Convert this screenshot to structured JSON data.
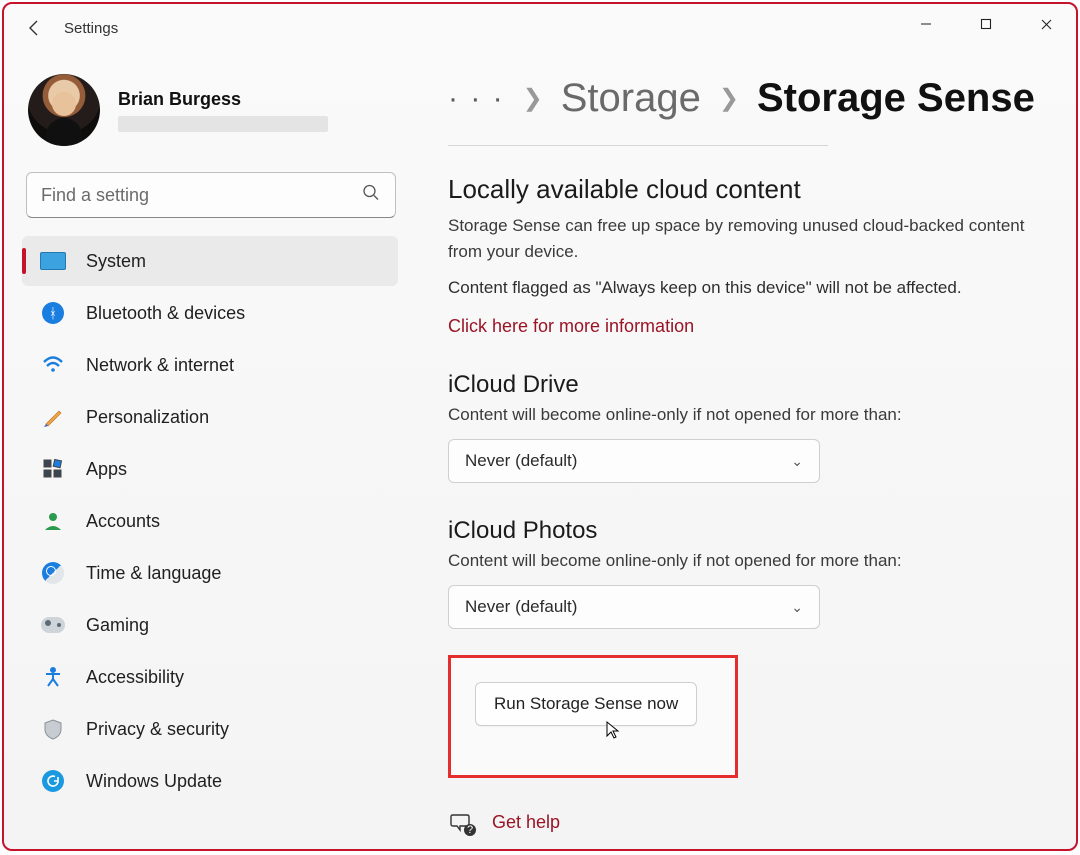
{
  "titlebar": {
    "title": "Settings"
  },
  "user": {
    "name": "Brian Burgess"
  },
  "search": {
    "placeholder": "Find a setting"
  },
  "nav": {
    "items": [
      {
        "label": "System"
      },
      {
        "label": "Bluetooth & devices"
      },
      {
        "label": "Network & internet"
      },
      {
        "label": "Personalization"
      },
      {
        "label": "Apps"
      },
      {
        "label": "Accounts"
      },
      {
        "label": "Time & language"
      },
      {
        "label": "Gaming"
      },
      {
        "label": "Accessibility"
      },
      {
        "label": "Privacy & security"
      },
      {
        "label": "Windows Update"
      }
    ]
  },
  "breadcrumb": {
    "ellipsis": "· · ·",
    "parent": "Storage",
    "current": "Storage Sense"
  },
  "cloud": {
    "title": "Locally available cloud content",
    "desc": "Storage Sense can free up space by removing unused cloud-backed content from your device.",
    "note": "Content flagged as \"Always keep on this device\" will not be affected.",
    "link": "Click here for more information"
  },
  "icloud_drive": {
    "title": "iCloud Drive",
    "sub": "Content will become online-only if not opened for more than:",
    "value": "Never (default)"
  },
  "icloud_photos": {
    "title": "iCloud Photos",
    "sub": "Content will become online-only if not opened for more than:",
    "value": "Never (default)"
  },
  "run_button": "Run Storage Sense now",
  "help": {
    "label": "Get help"
  }
}
